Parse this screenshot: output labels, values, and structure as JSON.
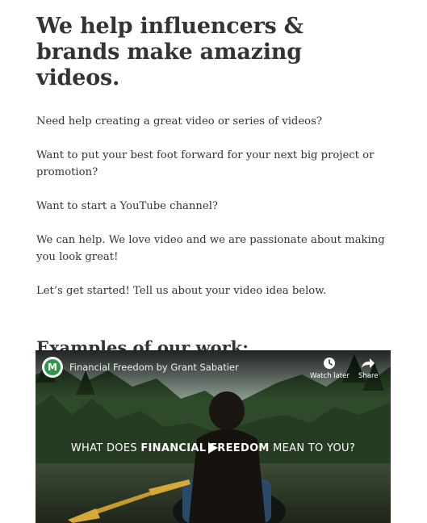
{
  "heading": "We help influencers & brands make amazing videos.",
  "paragraphs": [
    "Need help creating a great video or series of videos?",
    "Want to put your best foot forward for your next big project or promotion?",
    "Want to start a YouTube channel?",
    "We can help. We love video and we are passionate about making you look great!",
    "Let’s get started! Tell us about your video idea below."
  ],
  "examples_heading": "Examples of our work:",
  "video": {
    "title": "Financial Freedom by Grant Sabatier",
    "channel_logo_letter": "M",
    "watch_later_label": "Watch later",
    "share_label": "Share",
    "caption_before": "WHAT DOES ",
    "caption_bold": "FINANCIAL FREEDOM",
    "caption_after": " MEAN TO YOU?",
    "icons": {
      "watch_later": "clock-icon",
      "share": "share-arrow-icon",
      "play": "play-icon"
    }
  },
  "colors": {
    "text": "#333333",
    "channel_logo_green": "#2e9a45"
  }
}
